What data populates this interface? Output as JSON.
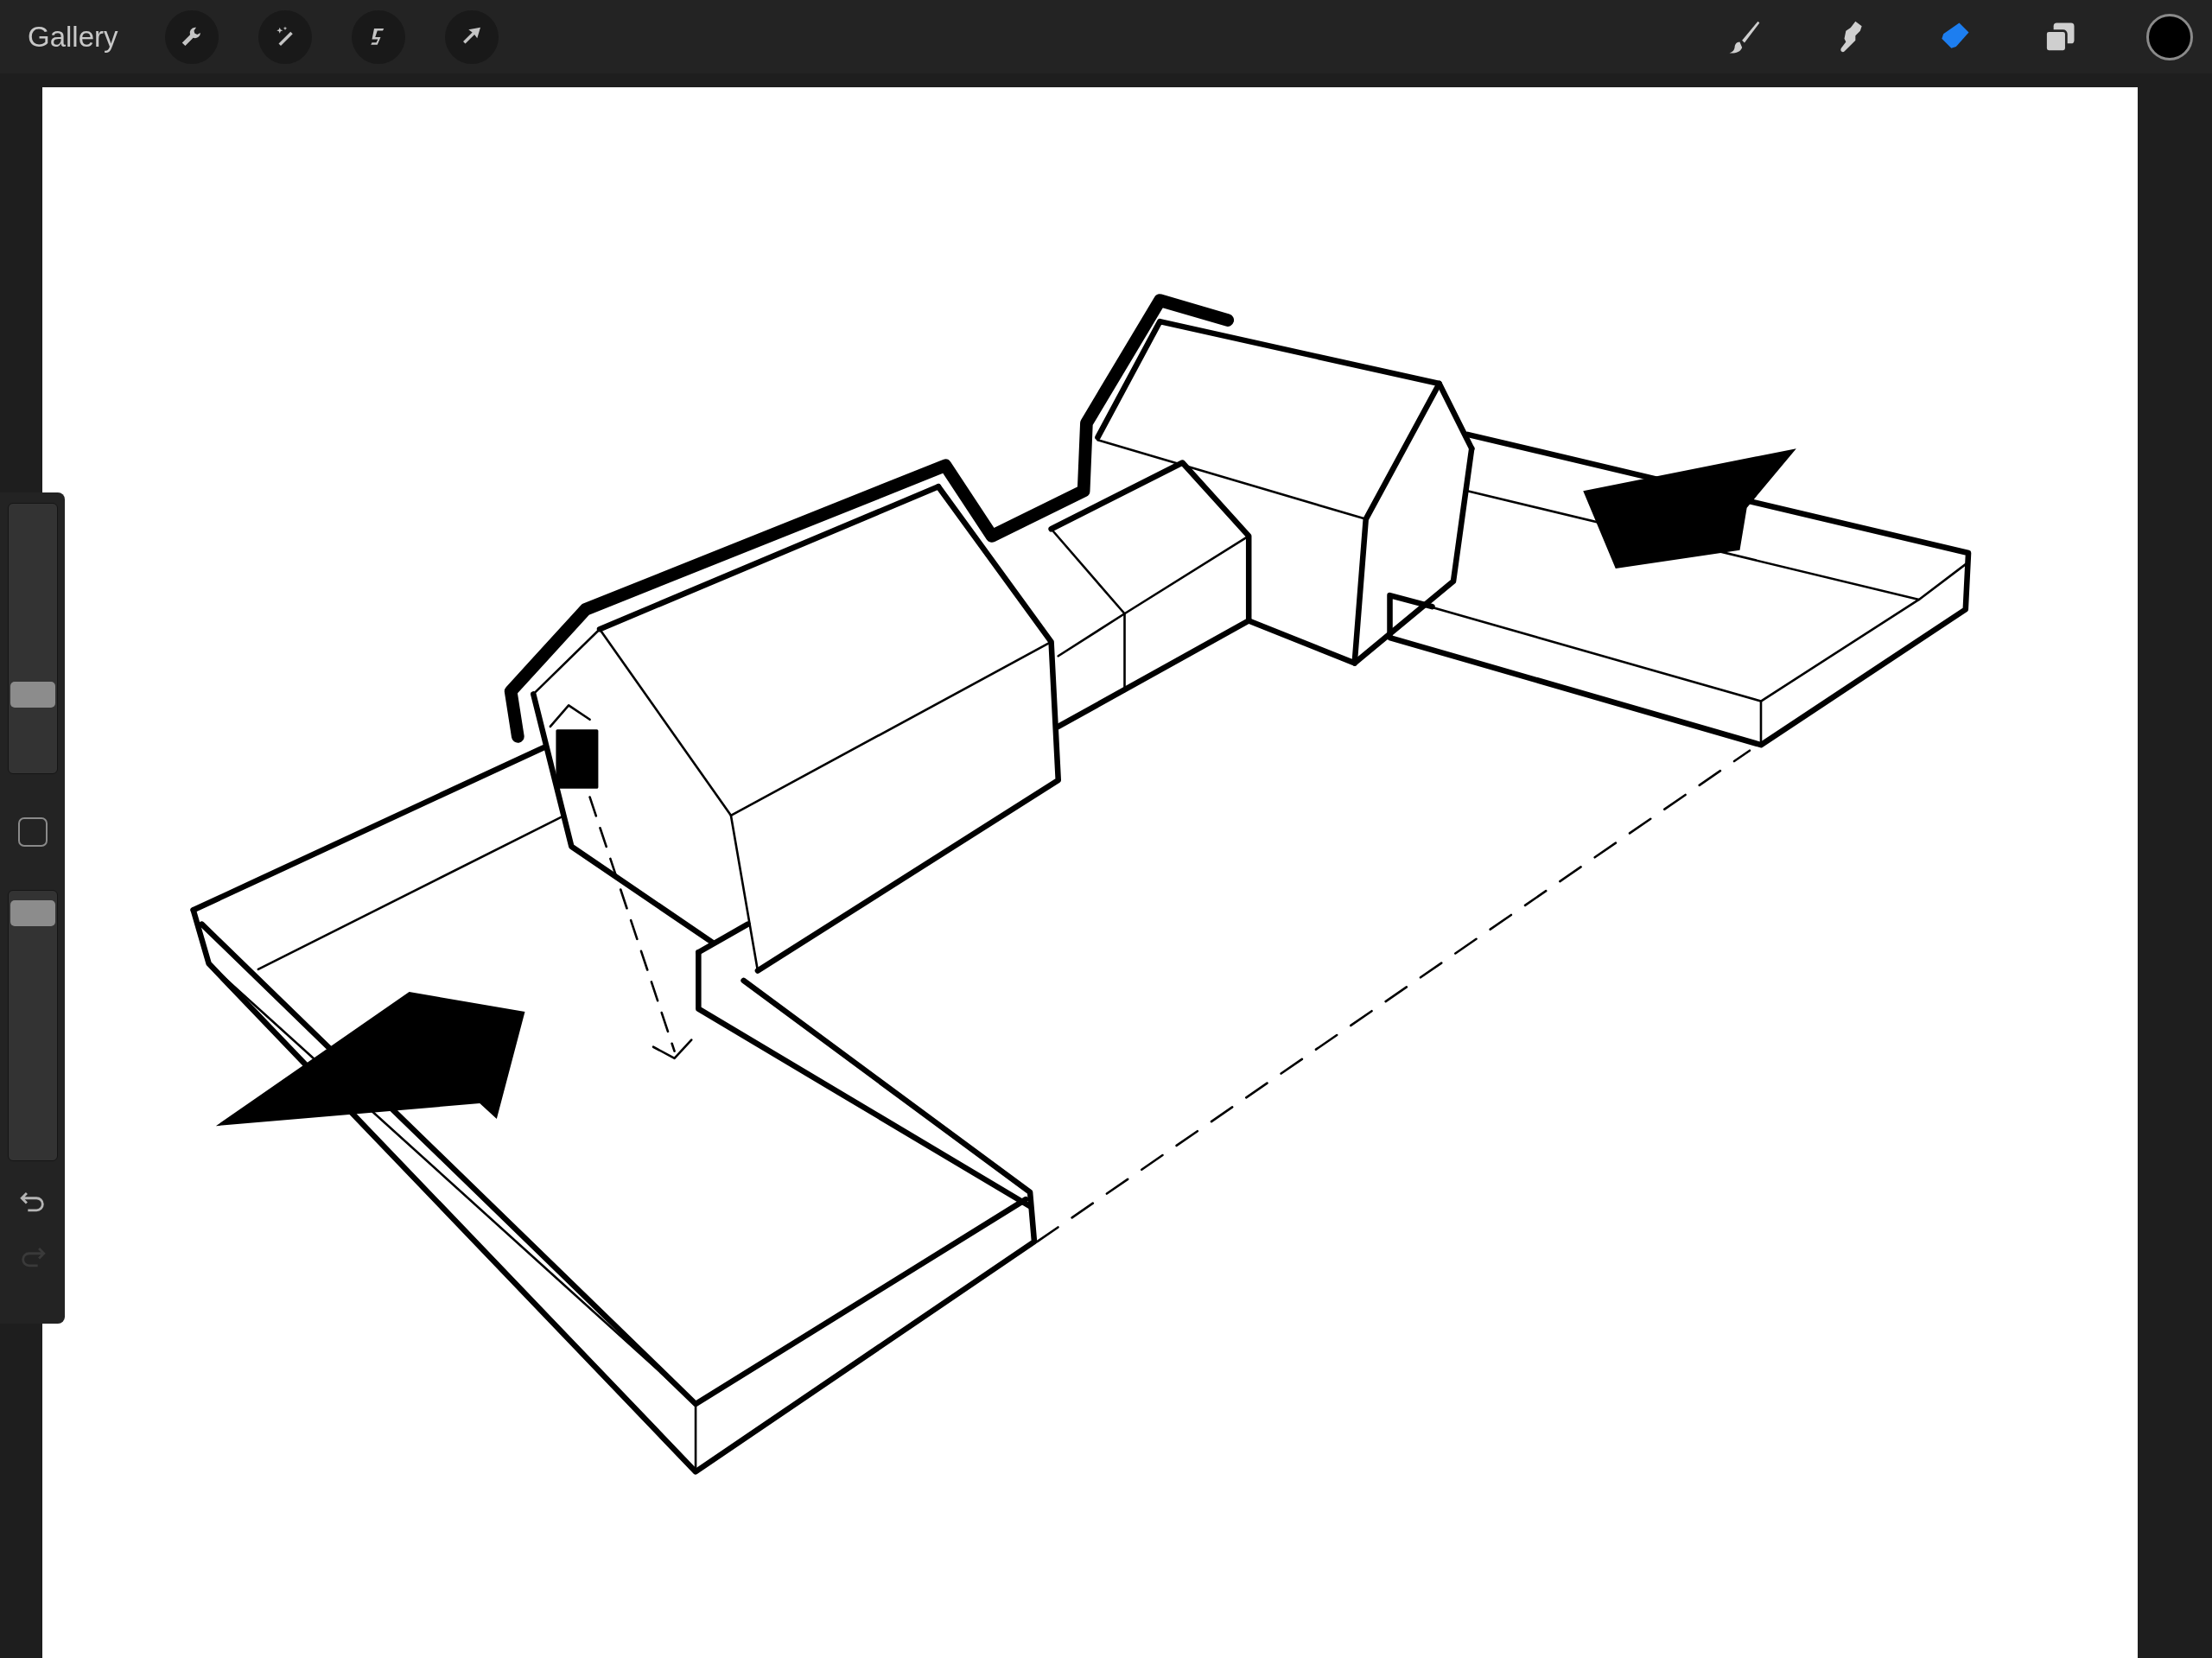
{
  "top_bar": {
    "gallery": "Gallery",
    "actions": [
      {
        "kind": "adjust"
      },
      {
        "kind": "magic"
      },
      {
        "kind": "select"
      },
      {
        "kind": "transform"
      }
    ],
    "tools": [
      {
        "kind": "brush",
        "selected": false
      },
      {
        "kind": "smudge",
        "selected": false
      },
      {
        "kind": "eraser",
        "selected": true
      },
      {
        "kind": "layers",
        "selected": false
      }
    ],
    "color_swatch": {
      "color": "#000000"
    }
  },
  "sidebar": {
    "brush_size": {
      "level": 0.27
    },
    "opacity": {
      "level": 0.96
    },
    "undo": {
      "disabled": false
    },
    "redo": {
      "disabled": true
    }
  }
}
